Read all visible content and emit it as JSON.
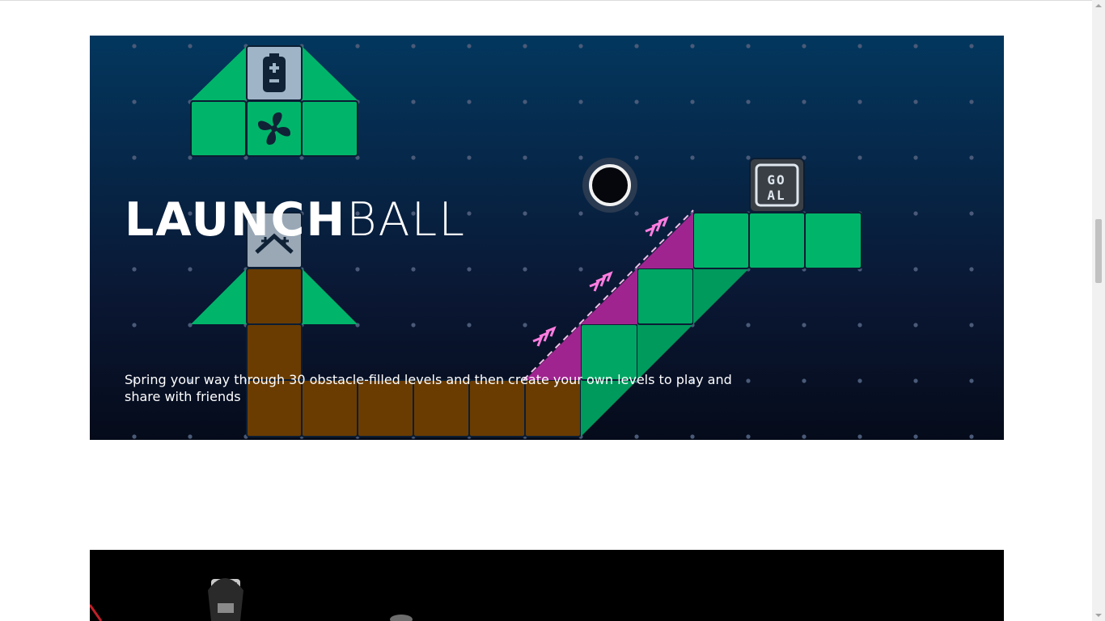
{
  "feature": {
    "title_bold": "LAUNCH",
    "title_light": "BALL",
    "description": "Spring your way through 30 obstacle-filled levels and then create your own levels to play and share with friends",
    "goal_label_line1": "GO",
    "goal_label_line2": "AL"
  },
  "colors": {
    "green": "#00b56a",
    "orange": "#6a3c02",
    "magenta": "#a0248f",
    "background_top": "#03375e",
    "background_bottom": "#050b1a"
  }
}
